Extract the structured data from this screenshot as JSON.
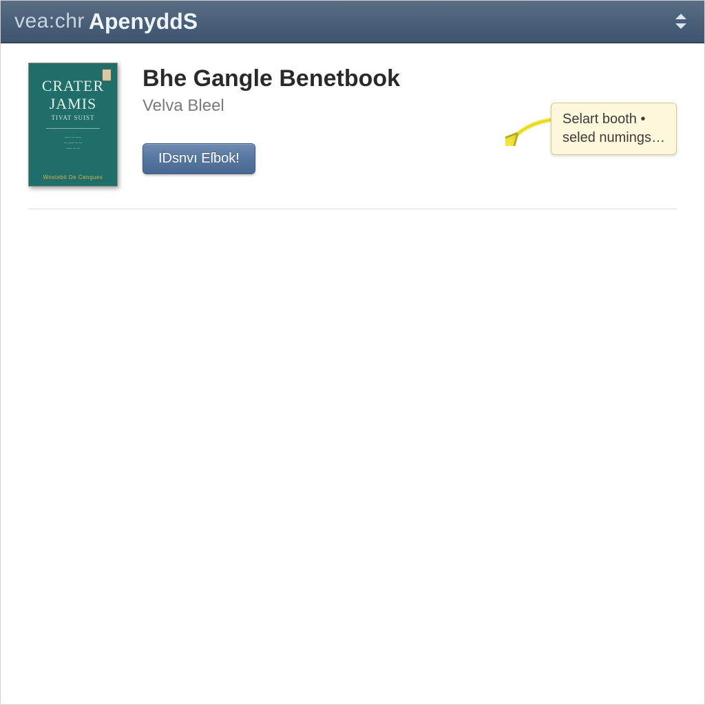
{
  "header": {
    "prefix": "vea:chr",
    "title": "ApenyddS"
  },
  "book": {
    "title": "Bhe Gangle Benetbook",
    "author": "Velva Bleel",
    "action_label": "IDsnvı Eſbok!",
    "cover": {
      "line1": "CRATER",
      "line2": "JAMIS",
      "subtitle": "TIVAT SUIST",
      "footer": "Wostebil De Cengues"
    }
  },
  "tooltip": {
    "line1": "Selart booth •",
    "line2": "seled numings…"
  },
  "colors": {
    "header_bg": "#4a6078",
    "button_bg": "#5676a0",
    "tooltip_bg": "#fdf7dc",
    "tooltip_border": "#d6c98a",
    "cover_bg": "#1f6e6a"
  }
}
